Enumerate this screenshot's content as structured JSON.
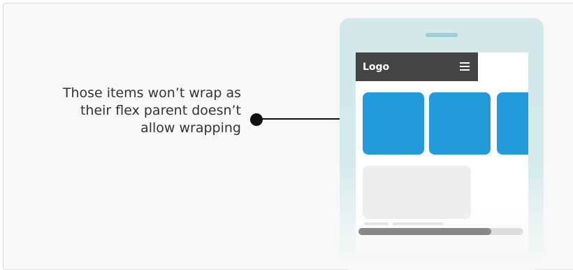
{
  "annotation": {
    "lines": [
      "Those items won’t wrap as",
      "their flex parent doesn’t",
      "allow wrapping"
    ]
  },
  "phone": {
    "navbar": {
      "logo": "Logo",
      "menu_icon": "hamburger-icon"
    },
    "flex_items_count": 3,
    "scroll_position": 0.8
  },
  "colors": {
    "frame_background": "#f8f8f8",
    "phone_body": "#d2e8e9",
    "speaker": "#9fd0d1",
    "navbar": "#444444",
    "flex_item": "#239ad9",
    "placeholder": "#eeeeee",
    "scroll_thumb": "#888888",
    "scroll_track": "#dddddd",
    "pointer": "#111111"
  }
}
